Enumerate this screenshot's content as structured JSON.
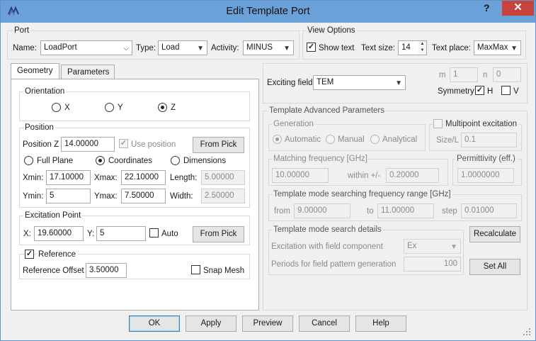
{
  "window": {
    "title": "Edit Template Port",
    "help": "?",
    "close": "✕"
  },
  "port": {
    "group": "Port",
    "name_label": "Name:",
    "name_value": "LoadPort",
    "type_label": "Type:",
    "type_value": "Load",
    "activity_label": "Activity:",
    "activity_value": "MINUS"
  },
  "view_options": {
    "group": "View Options",
    "show_text": "Show text",
    "text_size_label": "Text size:",
    "text_size_value": "14",
    "text_place_label": "Text place:",
    "text_place_value": "MaxMax"
  },
  "tabs": [
    "Geometry",
    "Parameters"
  ],
  "orientation": {
    "group": "Orientation",
    "options": [
      "X",
      "Y",
      "Z"
    ],
    "selected": "Z"
  },
  "position": {
    "group": "Position",
    "pos_z_label": "Position Z",
    "pos_z_value": "14.00000",
    "use_position": "Use position",
    "from_pick": "From Pick",
    "modes": [
      "Full Plane",
      "Coordinates",
      "Dimensions"
    ],
    "xmin_label": "Xmin:",
    "xmin": "17.10000",
    "xmax_label": "Xmax:",
    "xmax": "22.10000",
    "length_label": "Length:",
    "length": "5.00000",
    "ymin_label": "Ymin:",
    "ymin": "5",
    "ymax_label": "Ymax:",
    "ymax": "7.50000",
    "width_label": "Width:",
    "width": "2.50000"
  },
  "excitation": {
    "group": "Excitation Point",
    "x_label": "X:",
    "x": "19.60000",
    "y_label": "Y:",
    "y": "5",
    "auto": "Auto",
    "from_pick": "From Pick"
  },
  "reference": {
    "label": "Reference",
    "offset_label": "Reference Offset",
    "offset": "3.50000",
    "snap_mesh": "Snap Mesh"
  },
  "exciting": {
    "label": "Exciting field",
    "value": "TEM",
    "m_label": "m",
    "m": "1",
    "n_label": "n",
    "n": "0",
    "symmetry_label": "Symmetry",
    "h": "H",
    "v": "V"
  },
  "advanced": {
    "group": "Template Advanced Parameters",
    "generation_group": "Generation",
    "generation_options": [
      "Automatic",
      "Manual",
      "Analytical"
    ],
    "multipoint": "Multipoint excitation",
    "size_label": "Size/L",
    "size": "0.1",
    "matching_group": "Matching frequency [GHz]",
    "matching": "10.00000",
    "within_label": "within +/-",
    "within": "0.20000",
    "permittivity_group": "Permittivity (eff.)",
    "permittivity": "1.0000000",
    "range_group": "Template mode searching frequency range [GHz]",
    "from_label": "from",
    "from": "9.00000",
    "to_label": "to",
    "to": "11.00000",
    "step_label": "step",
    "step": "0.01000",
    "details_group": "Template mode search details",
    "field_comp_label": "Excitation with field component",
    "field_comp": "Ex",
    "periods_label": "Periods for field pattern generation",
    "periods": "100",
    "recalculate": "Recalculate",
    "set_all": "Set All"
  },
  "footer": {
    "ok": "OK",
    "apply": "Apply",
    "preview": "Preview",
    "cancel": "Cancel",
    "help": "Help"
  }
}
